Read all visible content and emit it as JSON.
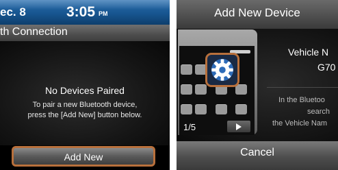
{
  "left_screen": {
    "status": {
      "date": "ec.  8",
      "time": "3:05",
      "ampm": "PM"
    },
    "title": "th Connection",
    "heading": "No Devices Paired",
    "message_line1": "To pair a new Bluetooth device,",
    "message_line2": "press the [Add New] button below.",
    "add_new_label": "Add New"
  },
  "right_screen": {
    "title": "Add New Device",
    "pager": "1/5",
    "vehicle_label": "Vehicle N",
    "vehicle_model": "G70",
    "instruction_line1": "In the Bluetoo",
    "instruction_line2": "search",
    "instruction_line3": "the Vehicle Nam",
    "cancel_label": "Cancel"
  },
  "colors": {
    "highlight": "#b8703c",
    "status_bar": "#17558f"
  },
  "icons": [
    "settings-gear-icon",
    "play-icon"
  ]
}
